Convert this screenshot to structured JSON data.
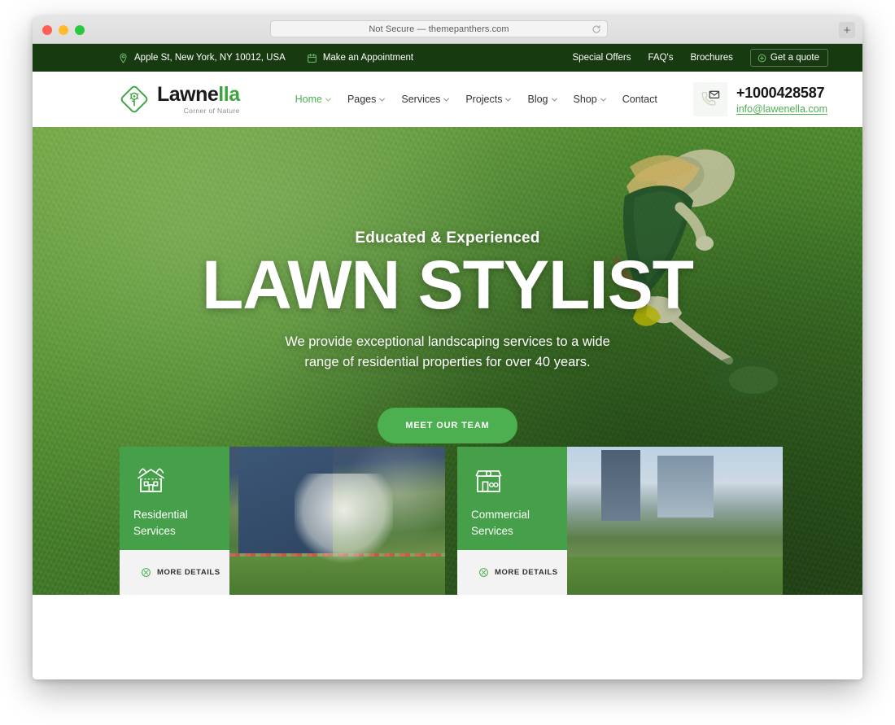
{
  "browser": {
    "url_text": "Not Secure — themepanthers.com",
    "reload_icon": "reload-icon",
    "newtab_label": "+"
  },
  "topbar": {
    "address": "Apple St, New York, NY 10012, USA",
    "address_icon": "location-pin-icon",
    "appointment": "Make an Appointment",
    "appointment_icon": "calendar-icon",
    "links": [
      {
        "label": "Special Offers"
      },
      {
        "label": "FAQ's"
      },
      {
        "label": "Brochures"
      }
    ],
    "quote_label": "Get a quote",
    "quote_icon": "plus-circle-icon",
    "bg_color": "#173a10"
  },
  "header": {
    "logo_word_1": "Lawne",
    "logo_word_2": "lla",
    "logo_tagline": "Corner of Nature",
    "logo_icon": "leaf-diamond-icon",
    "nav": [
      {
        "label": "Home",
        "has_chevron": true,
        "active": true
      },
      {
        "label": "Pages",
        "has_chevron": true,
        "active": false
      },
      {
        "label": "Services",
        "has_chevron": true,
        "active": false
      },
      {
        "label": "Projects",
        "has_chevron": true,
        "active": false
      },
      {
        "label": "Blog",
        "has_chevron": true,
        "active": false
      },
      {
        "label": "Shop",
        "has_chevron": true,
        "active": false
      },
      {
        "label": "Contact",
        "has_chevron": false,
        "active": false
      }
    ],
    "contact_icon": "phone-envelope-icon",
    "phone": "+1000428587",
    "email": "info@lawenella.com",
    "accent_color": "#4caf50"
  },
  "hero": {
    "kicker": "Educated & Experienced",
    "title": "LAWN STYLIST",
    "subtitle": "We provide exceptional landscaping services to a wide range of residential properties for over 40 years.",
    "cta_label": "MEET OUR TEAM",
    "cta_color": "#4caf50"
  },
  "services": [
    {
      "title": "Residential Services",
      "icon": "house-with-trees-icon",
      "more_label": "MORE DETAILS",
      "more_icon": "circle-cross-icon",
      "photo": "residential-house-garden-photo"
    },
    {
      "title": "Commercial Services",
      "icon": "storefront-icon",
      "more_label": "MORE DETAILS",
      "more_icon": "circle-cross-icon",
      "photo": "city-park-skyline-photo"
    }
  ],
  "colors": {
    "dark_green": "#173a10",
    "card_green": "#46a04a",
    "accent_green": "#4caf50"
  }
}
